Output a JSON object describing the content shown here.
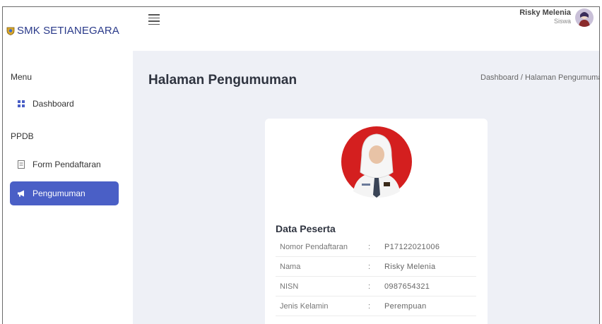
{
  "brand": {
    "name": "SMK SETIANEGARA"
  },
  "sidebar": {
    "headings": [
      "Menu",
      "PPDB"
    ],
    "items": [
      {
        "label": "Dashboard",
        "icon": "grid-icon",
        "active": false
      },
      {
        "label": "Form Pendaftaran",
        "icon": "document-icon",
        "active": false
      },
      {
        "label": "Pengumuman",
        "icon": "megaphone-icon",
        "active": true
      }
    ]
  },
  "topbar": {
    "user": {
      "name": "Risky Melenia",
      "role": "Siswa"
    }
  },
  "main": {
    "title": "Halaman Pengumuman",
    "breadcrumb": "Dashboard / Halaman Pengumuman"
  },
  "card": {
    "title": "Data Peserta",
    "separator": ":",
    "rows": [
      {
        "label": "Nomor Pendaftaran",
        "value": "P17122021006"
      },
      {
        "label": "Nama",
        "value": "Risky Melenia"
      },
      {
        "label": "NISN",
        "value": "0987654321"
      },
      {
        "label": "Jenis Kelamin",
        "value": "Perempuan"
      }
    ]
  },
  "colors": {
    "accent": "#4a5fc6",
    "background": "#eef0f6",
    "brand_text": "#2a3a8a",
    "photo_bg": "#d41f1f"
  }
}
